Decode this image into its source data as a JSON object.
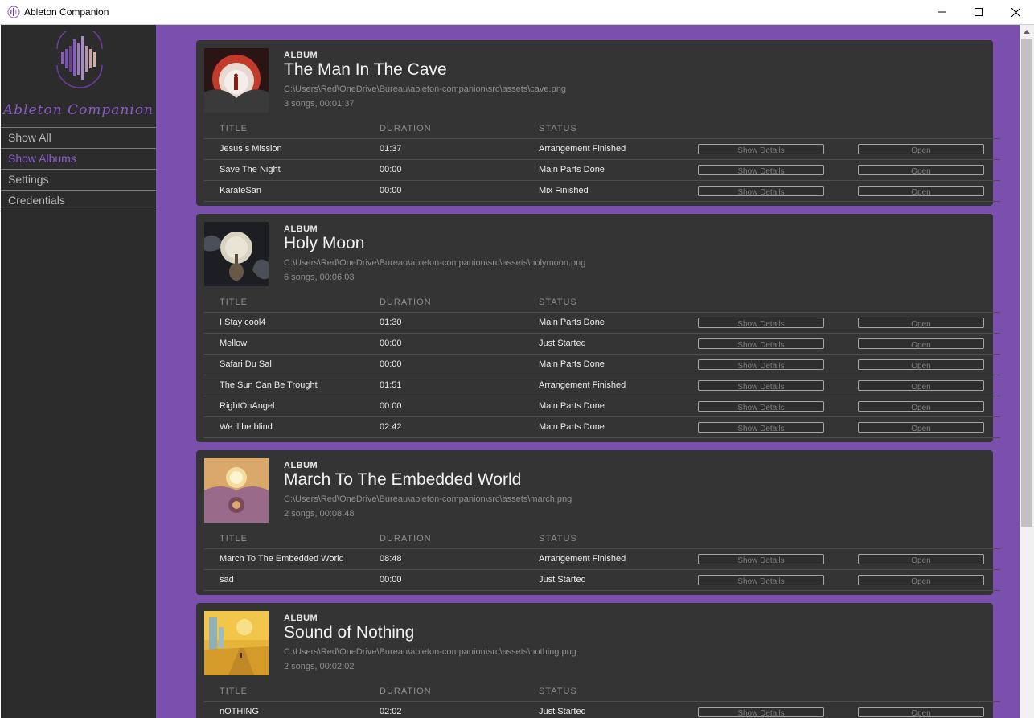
{
  "window": {
    "title": "Ableton Companion"
  },
  "sidebar": {
    "logo_text": "Ableton Companion",
    "items": [
      {
        "label": "Show All",
        "active": false
      },
      {
        "label": "Show Albums",
        "active": true
      },
      {
        "label": "Settings",
        "active": false
      },
      {
        "label": "Credentials",
        "active": false
      }
    ]
  },
  "table_headers": {
    "title": "TITLE",
    "duration": "DURATION",
    "status": "STATUS"
  },
  "buttons": {
    "details": "Show Details",
    "open": "Open"
  },
  "albums": [
    {
      "kind": "ALBUM",
      "title": "The Man In The Cave",
      "path": "C:\\Users\\Red\\OneDrive\\Bureau\\ableton-companion\\src\\assets\\cave.png",
      "meta": "3 songs, 00:01:37",
      "cover": "cave",
      "songs": [
        {
          "title": "Jesus s Mission",
          "duration": "01:37",
          "status": "Arrangement Finished"
        },
        {
          "title": "Save The Night",
          "duration": "00:00",
          "status": "Main Parts Done"
        },
        {
          "title": "KarateSan",
          "duration": "00:00",
          "status": "Mix Finished"
        }
      ]
    },
    {
      "kind": "ALBUM",
      "title": "Holy Moon",
      "path": "C:\\Users\\Red\\OneDrive\\Bureau\\ableton-companion\\src\\assets\\holymoon.png",
      "meta": "6 songs, 00:06:03",
      "cover": "moon",
      "songs": [
        {
          "title": "I Stay cool4",
          "duration": "01:30",
          "status": "Main Parts Done"
        },
        {
          "title": "Mellow",
          "duration": "00:00",
          "status": "Just Started"
        },
        {
          "title": "Safari Du Sal",
          "duration": "00:00",
          "status": "Main Parts Done"
        },
        {
          "title": "The Sun Can Be Trought",
          "duration": "01:51",
          "status": "Arrangement Finished"
        },
        {
          "title": "RightOnAngel",
          "duration": "00:00",
          "status": "Main Parts Done"
        },
        {
          "title": "We ll be blind",
          "duration": "02:42",
          "status": "Main Parts Done"
        }
      ]
    },
    {
      "kind": "ALBUM",
      "title": "March To The Embedded World",
      "path": "C:\\Users\\Red\\OneDrive\\Bureau\\ableton-companion\\src\\assets\\march.png",
      "meta": "2 songs, 00:08:48",
      "cover": "march",
      "songs": [
        {
          "title": "March To The Embedded World",
          "duration": "08:48",
          "status": "Arrangement Finished"
        },
        {
          "title": "sad",
          "duration": "00:00",
          "status": "Just Started"
        }
      ]
    },
    {
      "kind": "ALBUM",
      "title": "Sound of Nothing",
      "path": "C:\\Users\\Red\\OneDrive\\Bureau\\ableton-companion\\src\\assets\\nothing.png",
      "meta": "2 songs, 00:02:02",
      "cover": "nothing",
      "songs": [
        {
          "title": "nOTHING",
          "duration": "02:02",
          "status": "Just Started"
        }
      ]
    }
  ],
  "colors": {
    "accent": "#8a5cc9",
    "background": "#7b4fae",
    "card": "#343434",
    "sidebar": "#2c2c2c"
  }
}
